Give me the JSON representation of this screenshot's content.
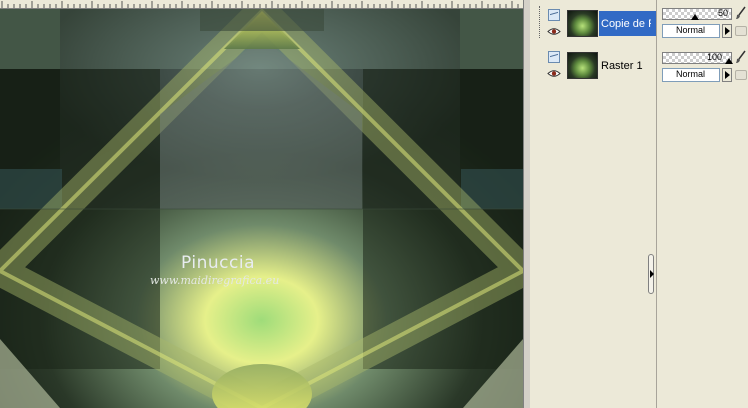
{
  "canvas": {
    "watermark_name": "Pinuccia",
    "watermark_url": "www.maidiregrafica.eu"
  },
  "layers": {
    "items": [
      {
        "name": "Copie de R",
        "selected": true,
        "visible": true,
        "type_icon": "raster-layer-icon"
      },
      {
        "name": "Raster 1",
        "selected": false,
        "visible": true,
        "type_icon": "raster-layer-icon"
      }
    ]
  },
  "properties": {
    "rows": [
      {
        "opacity": "50",
        "opacity_level": 0.5,
        "blend_mode": "Normal"
      },
      {
        "opacity": "100",
        "opacity_level": 1.0,
        "blend_mode": "Normal"
      }
    ]
  },
  "icons": {
    "visibility": "eye-icon",
    "edit": "brush-icon",
    "lock": "lock-icon",
    "expand": "chevron-right-icon"
  },
  "colors": {
    "selection": "#316ac5",
    "panel_bg": "#ece9d8"
  }
}
